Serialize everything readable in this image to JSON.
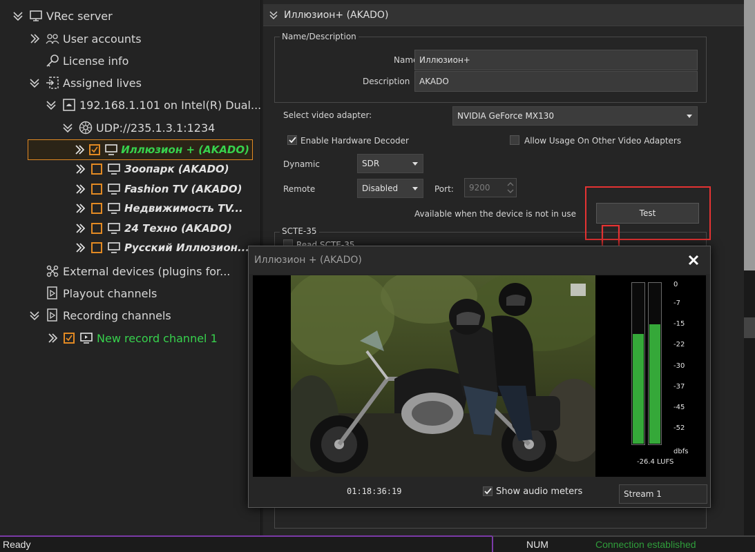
{
  "tree": {
    "items": [
      {
        "label": "VRec server"
      },
      {
        "label": "User accounts"
      },
      {
        "label": "License info"
      },
      {
        "label": "Assigned lives"
      },
      {
        "label": "192.168.1.101 on Intel(R) Dual..."
      },
      {
        "label": "UDP://235.1.3.1:1234"
      },
      {
        "label": "Иллюзион + (AKADO)"
      },
      {
        "label": "Зоопарк (AKADO)"
      },
      {
        "label": "Fashion TV (AKADO)"
      },
      {
        "label": "Недвижимость TV..."
      },
      {
        "label": "24 Техно (AKADO)"
      },
      {
        "label": "Русский Иллюзион..."
      },
      {
        "label": "External devices (plugins for..."
      },
      {
        "label": "Playout channels"
      },
      {
        "label": "Recording channels"
      },
      {
        "label": "New record channel 1"
      }
    ]
  },
  "props": {
    "header": "Иллюзион+ (AKADO)",
    "name_group_title": "Name/Description",
    "name_label": "Name",
    "name_value": "Иллюзион+",
    "description_label": "Description",
    "description_value": "AKADO",
    "video_adapter_label": "Select video adapter:",
    "video_adapter_value": "NVIDIA GeForce MX130",
    "enable_hw_decoder_label": "Enable Hardware Decoder",
    "enable_hw_decoder_checked": true,
    "allow_other_adapters_label": "Allow Usage On Other Video Adapters",
    "allow_other_adapters_checked": false,
    "dynamic_label": "Dynamic",
    "dynamic_value": "SDR",
    "remote_label": "Remote",
    "remote_value": "Disabled",
    "port_label": "Port:",
    "port_value": "9200",
    "availability_note": "Available when the device is not in use",
    "test_button": "Test",
    "scte_group_title": "SCTE-35",
    "read_scte_label": "Read SCTE-35"
  },
  "dialog": {
    "title": "Иллюзион + (AKADO)",
    "timecode": "01:18:36:19",
    "show_meters_label": "Show audio meters",
    "show_meters_checked": true,
    "stream_value": "Stream 1",
    "meter_scale": [
      "0",
      "-7",
      "-15",
      "-22",
      "-30",
      "-37",
      "-45",
      "-52"
    ],
    "meter_unit": "dbfs",
    "loudness": "-26.4 LUFS",
    "meter_levels_fraction": {
      "left": 0.68,
      "right": 0.74
    }
  },
  "status": {
    "left": "Ready",
    "mid": "NUM",
    "right": "Connection established"
  },
  "colors": {
    "accent_orange": "#e38a23",
    "active_green": "#37d24d",
    "annotation_red": "#e53333",
    "status_purple": "#7b3aa8",
    "connection_green": "#2f9e3b"
  }
}
